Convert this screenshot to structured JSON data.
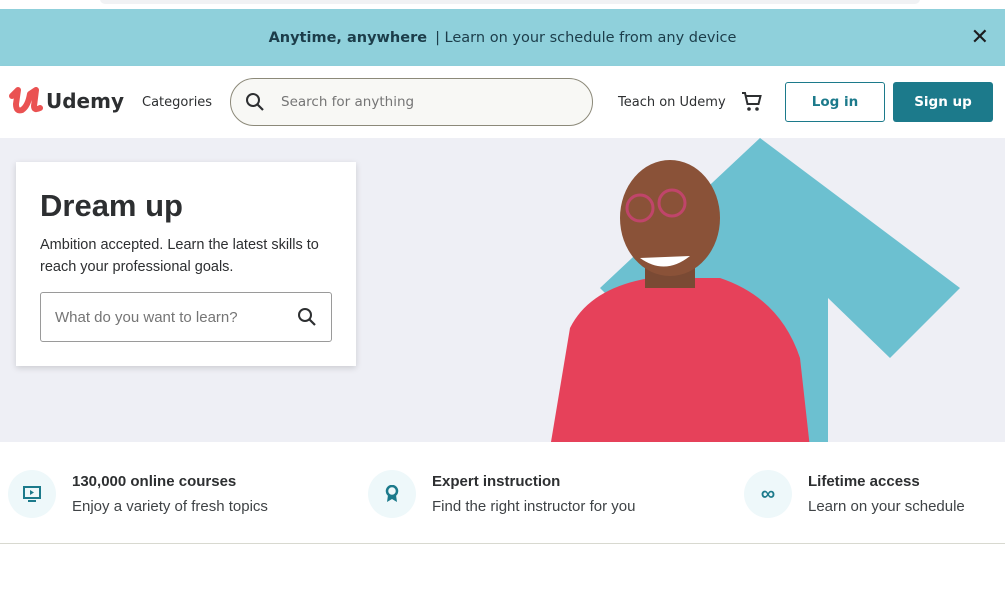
{
  "banner": {
    "title": "Anytime, anywhere",
    "text": "| Learn on your schedule from any device"
  },
  "nav": {
    "logo": "Udemy",
    "categories": "Categories",
    "search_placeholder": "Search for anything",
    "teach": "Teach on Udemy",
    "login": "Log in",
    "signup": "Sign up"
  },
  "hero": {
    "title": "Dream up",
    "subtitle": "Ambition accepted. Learn the latest skills to reach your professional goals.",
    "search_placeholder": "What do you want to learn?"
  },
  "features": [
    {
      "icon": "video-player-icon",
      "title": "130,000 online courses",
      "text": "Enjoy a variety of fresh topics"
    },
    {
      "icon": "award-ribbon-icon",
      "title": "Expert instruction",
      "text": "Find the right instructor for you"
    },
    {
      "icon": "infinity-icon",
      "title": "Lifetime access",
      "text": "Learn on your schedule"
    }
  ],
  "colors": {
    "banner": "#8fd0db",
    "brand": "#1c7a8b",
    "logo": "#ea5252"
  }
}
